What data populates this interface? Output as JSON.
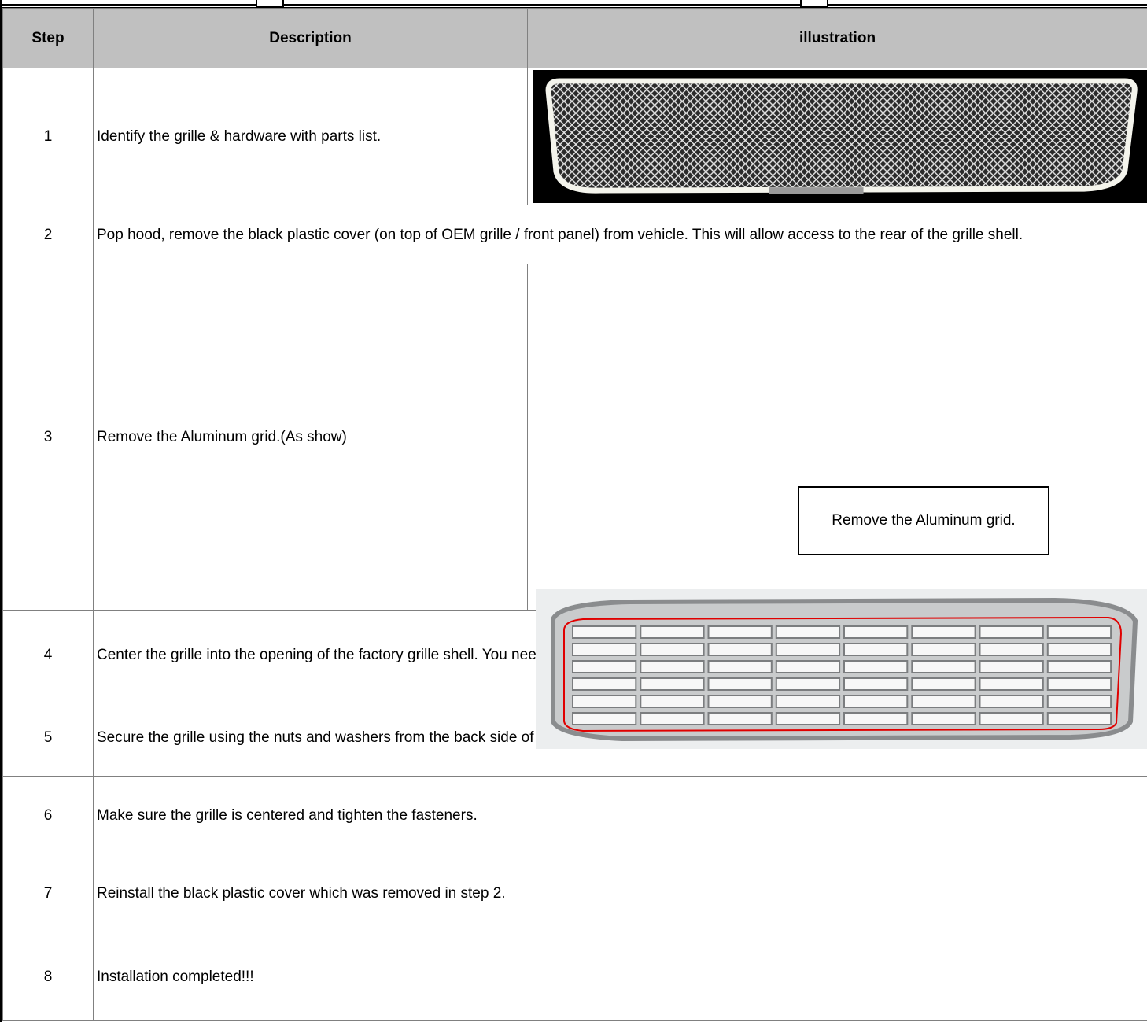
{
  "table": {
    "headers": {
      "step": "Step",
      "description": "Description",
      "illustration": "illustration"
    },
    "rows": [
      {
        "step": "1",
        "description": "Identify the grille & hardware with parts list."
      },
      {
        "step": "2",
        "description": "Pop hood, remove the black plastic cover (on top of OEM grille / front panel) from vehicle. This will allow access to the rear of the grille shell."
      },
      {
        "step": "3",
        "description": "Remove the Aluminum grid.(As show)",
        "callout": "Remove the Aluminum grid."
      },
      {
        "step": "4",
        "description": "Center the grille into the opening of the factory grille shell. You need mark and drill six holes. Be sure the bolts are through the grille shell."
      },
      {
        "step": "5",
        "description": "Secure the grille using the nuts and washers from the back side of the OEM grille shell."
      },
      {
        "step": "6",
        "description": "Make sure the grille is centered and tighten the fasteners."
      },
      {
        "step": "7",
        "description": "Reinstall the black plastic cover which was removed in step 2."
      },
      {
        "step": "8",
        "description": "Installation completed!!!"
      }
    ]
  },
  "colors": {
    "header_bg": "#c0c0c0",
    "callout_arrow": "#ff0000",
    "outline": "#e00000"
  },
  "icons": {
    "step1": "mesh-grille-photo",
    "step3": "chrome-grille-photo"
  }
}
